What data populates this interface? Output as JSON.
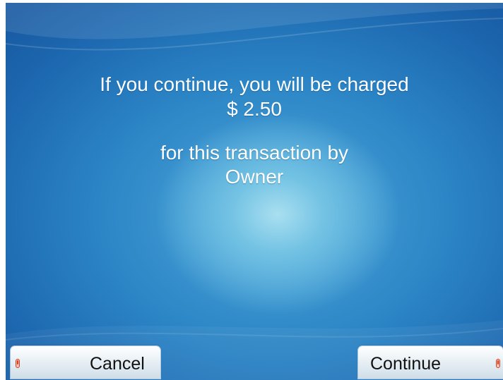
{
  "prompt": {
    "line1": "If you continue, you will be charged",
    "amount": "$ 2.50",
    "line3": "for this transaction by",
    "charger": "Owner"
  },
  "buttons": {
    "cancel_label": "Cancel",
    "continue_label": "Continue"
  },
  "colors": {
    "screen_dark": "#175aa2",
    "screen_light": "#a9dff0",
    "text": "#ffffff",
    "indicator": "#d93a1e"
  }
}
